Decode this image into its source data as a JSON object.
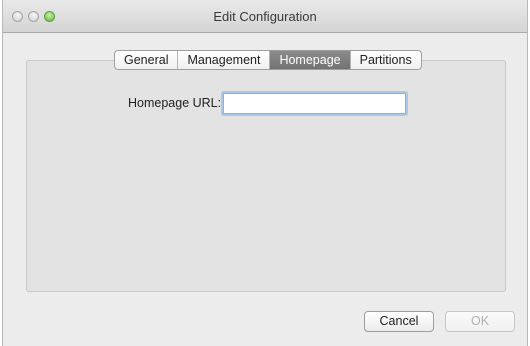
{
  "window": {
    "title": "Edit Configuration"
  },
  "tabs": [
    {
      "label": "General",
      "active": false
    },
    {
      "label": "Management",
      "active": false
    },
    {
      "label": "Homepage",
      "active": true
    },
    {
      "label": "Partitions",
      "active": false
    }
  ],
  "homepage": {
    "url_label": "Homepage URL:",
    "url_value": "",
    "url_placeholder": ""
  },
  "buttons": {
    "cancel_label": "Cancel",
    "ok_label": "OK",
    "ok_enabled": false
  },
  "colors": {
    "window_background": "#ececec",
    "group_background": "#e3e3e3",
    "active_tab": "#7d7d7d",
    "focus_ring": "#a9c8ec"
  }
}
